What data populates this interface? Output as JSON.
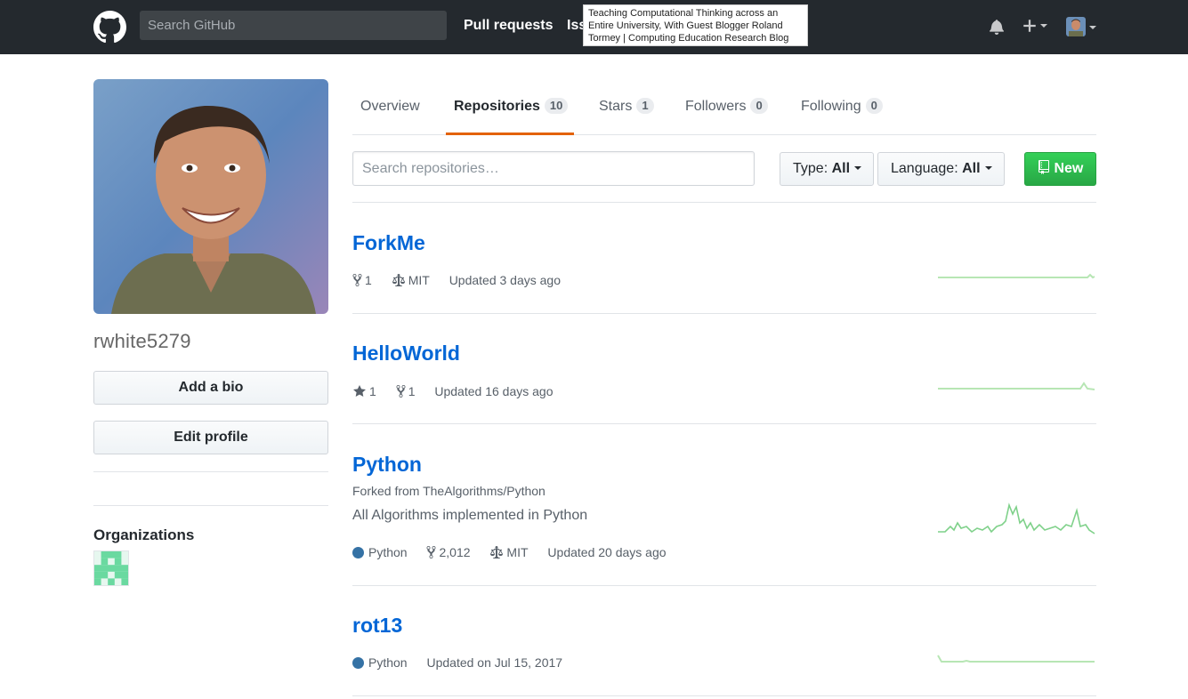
{
  "header": {
    "search_placeholder": "Search GitHub",
    "nav": [
      "Pull requests",
      "Iss"
    ],
    "tooltip_lines": [
      "Teaching Computational Thinking across an",
      "Entire University, With Guest Blogger Roland",
      "Tormey | Computing Education Research Blog"
    ]
  },
  "profile": {
    "username": "rwhite5279",
    "add_bio": "Add a bio",
    "edit_profile": "Edit profile",
    "organizations_title": "Organizations"
  },
  "tabs": [
    {
      "label": "Overview",
      "count": ""
    },
    {
      "label": "Repositories",
      "count": "10"
    },
    {
      "label": "Stars",
      "count": "1"
    },
    {
      "label": "Followers",
      "count": "0"
    },
    {
      "label": "Following",
      "count": "0"
    }
  ],
  "filters": {
    "search_placeholder": "Search repositories…",
    "type_label": "Type:",
    "type_value": "All",
    "language_label": "Language:",
    "language_value": "All",
    "new_label": "New"
  },
  "colors": {
    "header_bg": "#24292e",
    "link": "#0366d6",
    "active_tab": "#e36209",
    "new_button": "#28a745",
    "python": "#3572A5",
    "spark": "#9be9a8"
  },
  "repos": [
    {
      "name": "ForkMe",
      "forks": "1",
      "license": "MIT",
      "updated": "Updated 3 days ago"
    },
    {
      "name": "HelloWorld",
      "stars": "1",
      "forks": "1",
      "updated": "Updated 16 days ago"
    },
    {
      "name": "Python",
      "forked_from": "Forked from TheAlgorithms/Python",
      "description": "All Algorithms implemented in Python",
      "language": "Python",
      "forks": "2,012",
      "license": "MIT",
      "updated": "Updated 20 days ago"
    },
    {
      "name": "rot13",
      "language": "Python",
      "updated": "Updated on Jul 15, 2017"
    }
  ]
}
